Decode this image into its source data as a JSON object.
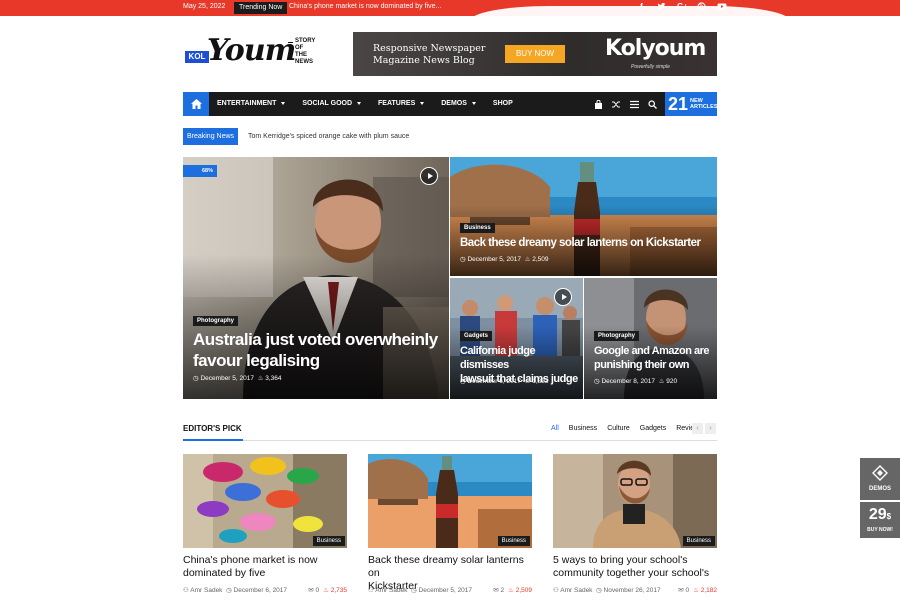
{
  "topbar": {
    "date": "May 25, 2022",
    "trending_label": "Trending Now",
    "trending_text": "China's phone market is now dominated by five...",
    "social_icons": [
      "facebook-icon",
      "twitter-icon",
      "google-plus-icon",
      "dribbble-icon",
      "youtube-icon"
    ]
  },
  "logo": {
    "kol": "KOL",
    "youm": "Youm",
    "tagline": [
      "STORY",
      "OF",
      "THE",
      "NEWS"
    ]
  },
  "banner": {
    "line1": "Responsive Newspaper",
    "line2": "Magazine News Blog",
    "button": "BUY NOW",
    "brand": "Kolyoum",
    "brand_sub": "Powerfully simple"
  },
  "nav": {
    "items": [
      {
        "label": "ENTERTAINMENT",
        "caret": true
      },
      {
        "label": "SOCIAL GOOD",
        "caret": true
      },
      {
        "label": "FEATURES",
        "caret": true
      },
      {
        "label": "DEMOS",
        "caret": true
      },
      {
        "label": "SHOP",
        "caret": false
      }
    ],
    "count_number": "21",
    "count_label_1": "NEW",
    "count_label_2": "ARTICLES"
  },
  "breaking": {
    "label": "Breaking News",
    "text": "Tom Kerridge's spiced orange cake with plum sauce"
  },
  "hero": {
    "main": {
      "badge": "68%",
      "category": "Photography",
      "title_1": "Australia just voted overwheinly",
      "title_2": "favour legalising",
      "date": "December 5, 2017",
      "views": "3,364"
    },
    "top_right": {
      "category": "Business",
      "title": "Back these dreamy solar lanterns on Kickstarter",
      "date": "December 5, 2017",
      "views": "2,509"
    },
    "bottom_left": {
      "category": "Gadgets",
      "title_1": "California judge dismisses",
      "title_2": "lawsuit that claims judge",
      "date": "December 6, 2017",
      "views": "1,323"
    },
    "bottom_right": {
      "category": "Photography",
      "title_1": "Google and Amazon are",
      "title_2": "punishing their own",
      "date": "December 8, 2017",
      "views": "920"
    }
  },
  "editors_pick": {
    "title": "EDITOR'S PICK",
    "filters": [
      "All",
      "Business",
      "Culture",
      "Gadgets",
      "Reviews"
    ],
    "cards": [
      {
        "category": "Business",
        "title_1": "China's phone market is now",
        "title_2": "dominated by five",
        "author": "Amr Sadek",
        "date": "December 6, 2017",
        "comments": "0",
        "views": "2,735"
      },
      {
        "category": "Business",
        "title_1": "Back these dreamy solar lanterns on",
        "title_2": "Kickstarter",
        "author": "Amr Sadek",
        "date": "December 5, 2017",
        "comments": "2",
        "views": "2,509"
      },
      {
        "category": "Business",
        "title_1": "5 ways to bring your school's",
        "title_2": "community together your school's",
        "author": "Amr Sadek",
        "date": "November 26, 2017",
        "comments": "0",
        "views": "2,182"
      }
    ]
  },
  "side": {
    "demos": "DEMOS",
    "price": "29",
    "price_sup": "$",
    "buy": "BUY NOW!"
  },
  "colors": {
    "accent": "#1d6fe0",
    "red": "#e8382a",
    "dark": "#1b1b1b"
  }
}
